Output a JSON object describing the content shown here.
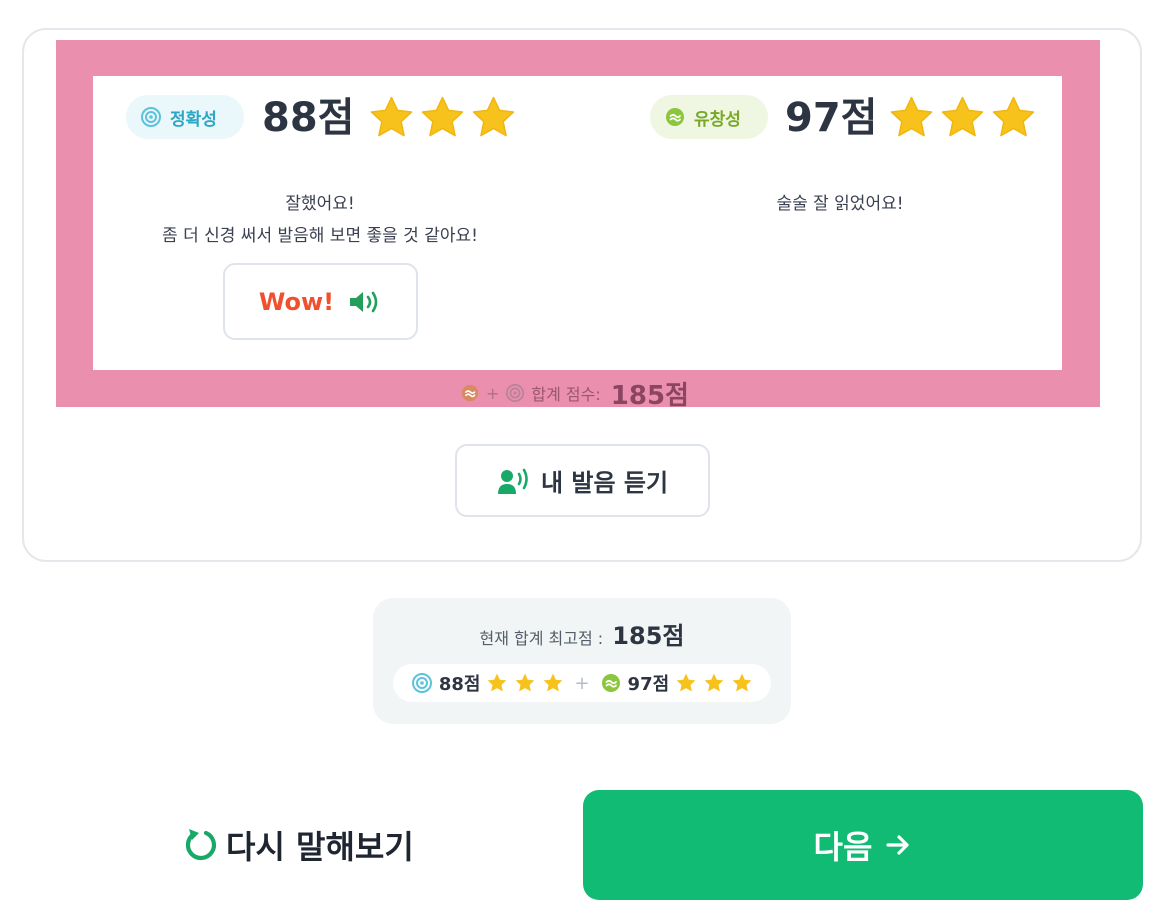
{
  "result": {
    "accuracy": {
      "label": "정확성",
      "score_text": "88점",
      "stars": 3,
      "feedback_line1": "잘했어요!",
      "feedback_line2": "좀 더 신경 써서 발음해 보면 좋을 것 같아요!",
      "wow_label": "Wow!"
    },
    "fluency": {
      "label": "유창성",
      "score_text": "97점",
      "stars": 3,
      "feedback_line1": "술술 잘 읽었어요!"
    },
    "total_label": "합계 점수:",
    "total_value": "185점",
    "listen_label": "내 발음 듣기"
  },
  "best": {
    "title": "현재 합계 최고점 :",
    "value": "185점",
    "accuracy_score": "88점",
    "fluency_score": "97점",
    "separator": "+"
  },
  "actions": {
    "retry_label": "다시 말해보기",
    "next_label": "다음"
  },
  "colors": {
    "accent_green": "#12bb74",
    "highlight_pink": "#ea8fad",
    "star_yellow": "#f7c21b",
    "accuracy_teal": "#2ba7c4",
    "fluency_green": "#78a82a"
  }
}
